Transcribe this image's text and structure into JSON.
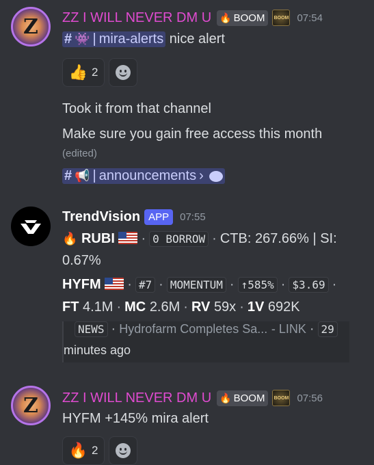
{
  "messages": [
    {
      "author": "ZZ I WILL NEVER DM U",
      "tag": "BOOM",
      "badge_text": "BOOM",
      "time": "07:54",
      "channel_mention": "mira-alerts",
      "text_after_mention": " nice alert",
      "reactions": [
        {
          "emoji_name": "thumbs-up",
          "count": "2"
        }
      ]
    },
    {
      "lines": [
        "Took it from that channel",
        "Make sure you gain free access this month"
      ],
      "edited": "(edited)",
      "channel_mention": "announcements"
    },
    {
      "author": "TrendVision",
      "app_tag": "APP",
      "time": "07:55",
      "rubi_label": "RUBI",
      "borrow_code": "0 BORROW",
      "ctb_text": "CTB: 267.66% | SI:",
      "si_value": "0.67%",
      "ticker": "HYFM",
      "rank": "#7",
      "momentum": "MOMENTUM",
      "change": "↑585%",
      "price": "$3.69",
      "ft_label": "FT",
      "ft_value": "4.1M",
      "mc_label": "MC",
      "mc_value": "2.6M",
      "rv_label": "RV",
      "rv_value": "59x",
      "v_label": "1V",
      "v_value": "692K",
      "news_code": "NEWS",
      "news_headline": "Hydrofarm Completes Sa...",
      "news_link": "LINK",
      "news_age_num": "29",
      "news_age_rest": "minutes ago"
    },
    {
      "author": "ZZ I WILL NEVER DM U",
      "tag": "BOOM",
      "badge_text": "BOOM",
      "time": "07:56",
      "text": "HYFM +145% mira alert",
      "reactions": [
        {
          "emoji_name": "fire",
          "count": "2"
        }
      ]
    }
  ],
  "colors": {
    "background": "#313338",
    "zz_name": "#e04bd0",
    "mention_bg": "#3c4270",
    "app_tag": "#5865f2",
    "link": "#00a8fc"
  }
}
